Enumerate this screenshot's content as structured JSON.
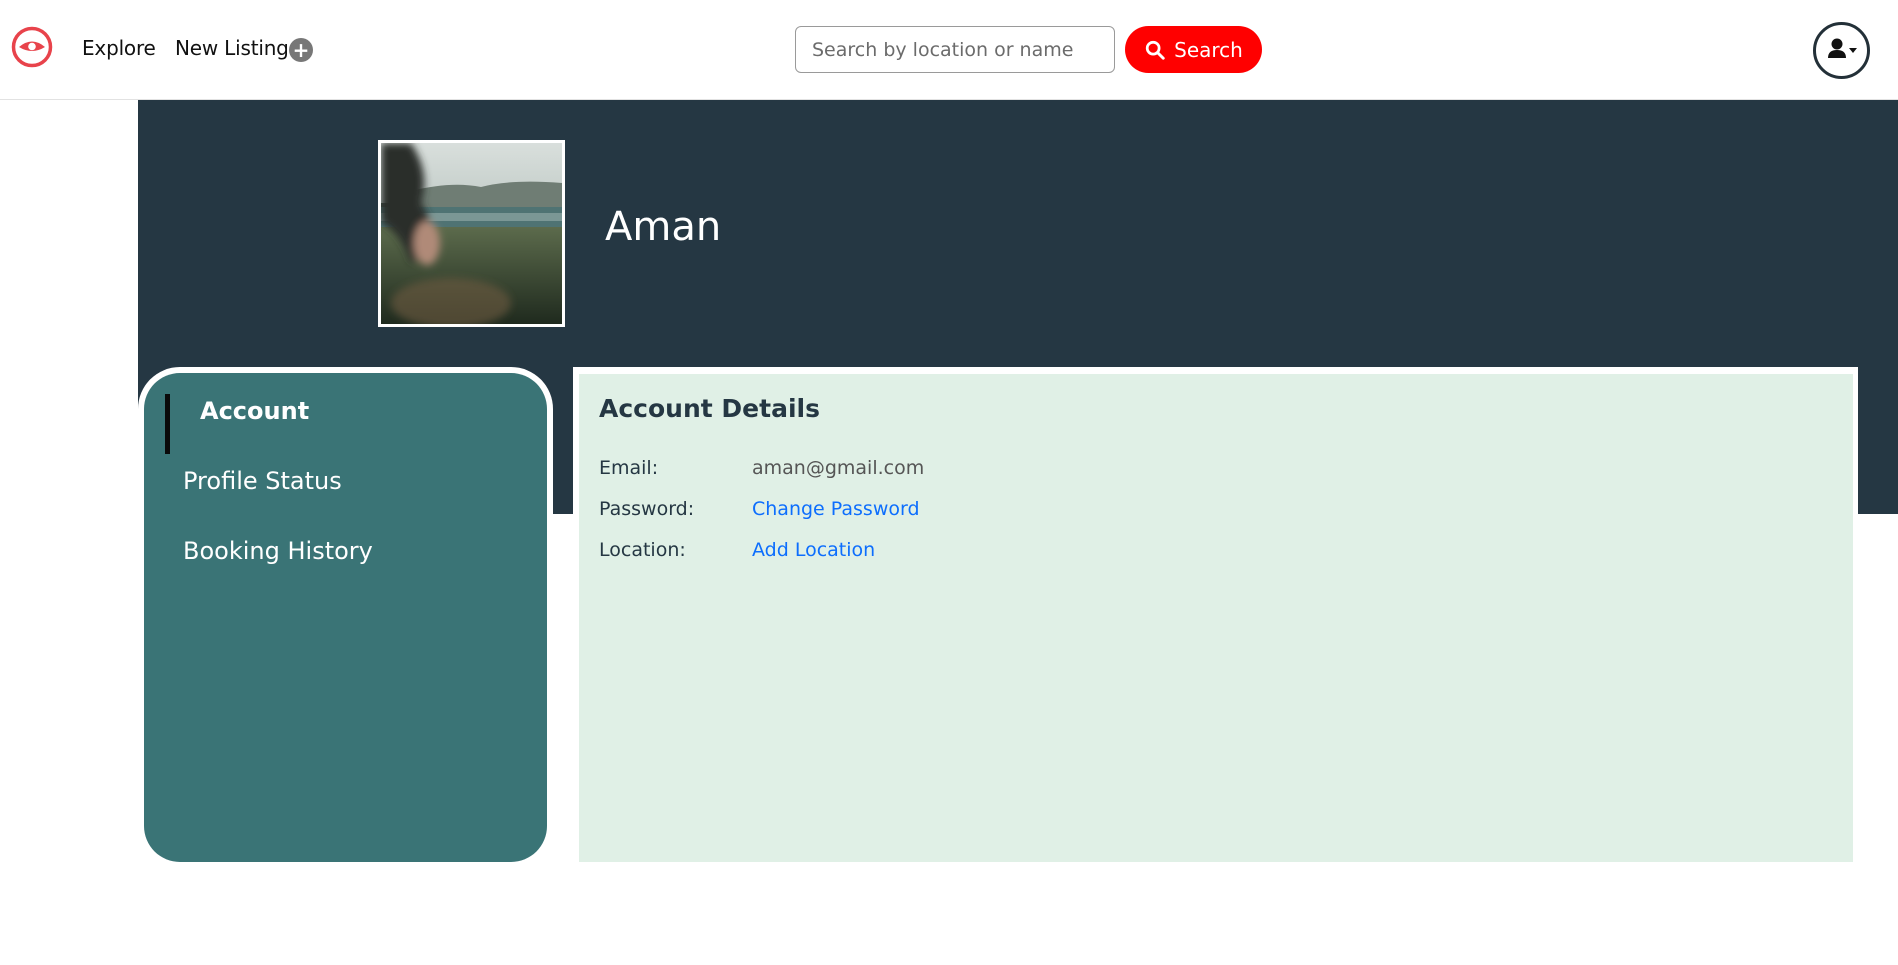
{
  "navbar": {
    "logo_icon": "eye-logo-icon",
    "links": [
      {
        "label": "Explore"
      },
      {
        "label": "New Listing"
      }
    ],
    "new_listing_icon": "plus-circle-icon",
    "search": {
      "placeholder": "Search by location or name",
      "value": "",
      "button_label": "Search",
      "button_icon": "search-icon"
    },
    "user_menu_icon": "user-dropdown-icon"
  },
  "profile": {
    "name": "Aman",
    "avatar_icon": "profile-photo"
  },
  "sidebar": {
    "items": [
      {
        "label": "Account",
        "active": true
      },
      {
        "label": "Profile Status",
        "active": false
      },
      {
        "label": "Booking History",
        "active": false
      }
    ]
  },
  "account_details": {
    "title": "Account Details",
    "fields": [
      {
        "label": "Email:",
        "value": "aman@gmail.com"
      },
      {
        "label": "Password:",
        "value": "Change Password"
      },
      {
        "label": "Location:",
        "value": "Add Location"
      }
    ]
  },
  "colors": {
    "brand_red": "#ff0000",
    "banner": "#253743",
    "sidebar": "#3a7476",
    "panel": "#e0f0e6",
    "link": "#0d6efd"
  }
}
